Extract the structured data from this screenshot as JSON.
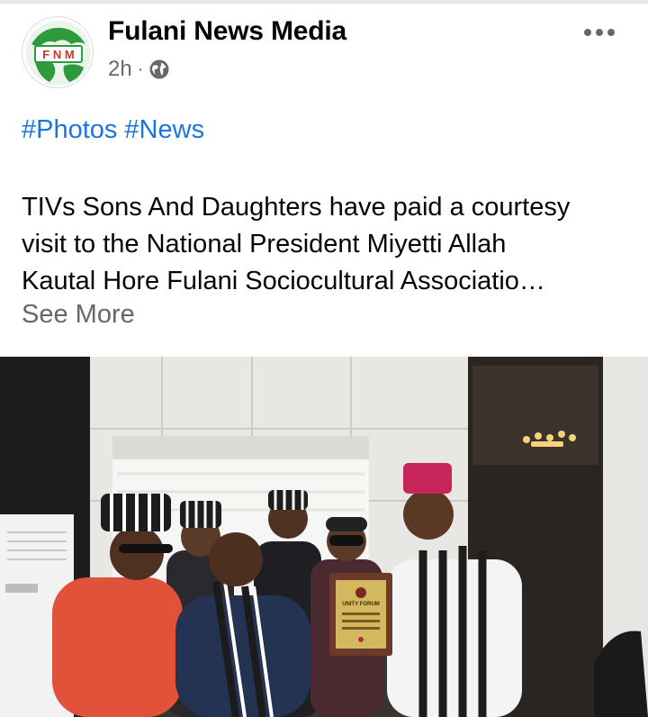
{
  "post": {
    "page_name": "Fulani News Media",
    "time": "2h",
    "separator": "·",
    "audience_icon": "globe-icon",
    "more_icon": "more-options-icon",
    "avatar_text": "F N M",
    "hashtags": [
      "#Photos",
      "#News"
    ],
    "body_lines": [
      "TIVs Sons And Daughters have paid a courtesy",
      "visit to the National President Miyetti Allah",
      "Kautal Hore Fulani Sociocultural Associatio…"
    ],
    "see_more": "See More",
    "plaque_title": "UNITY FORUM"
  },
  "colors": {
    "link": "#1b74e4",
    "secondary_text": "#65676b",
    "avatar_green": "#2e9a3e"
  }
}
